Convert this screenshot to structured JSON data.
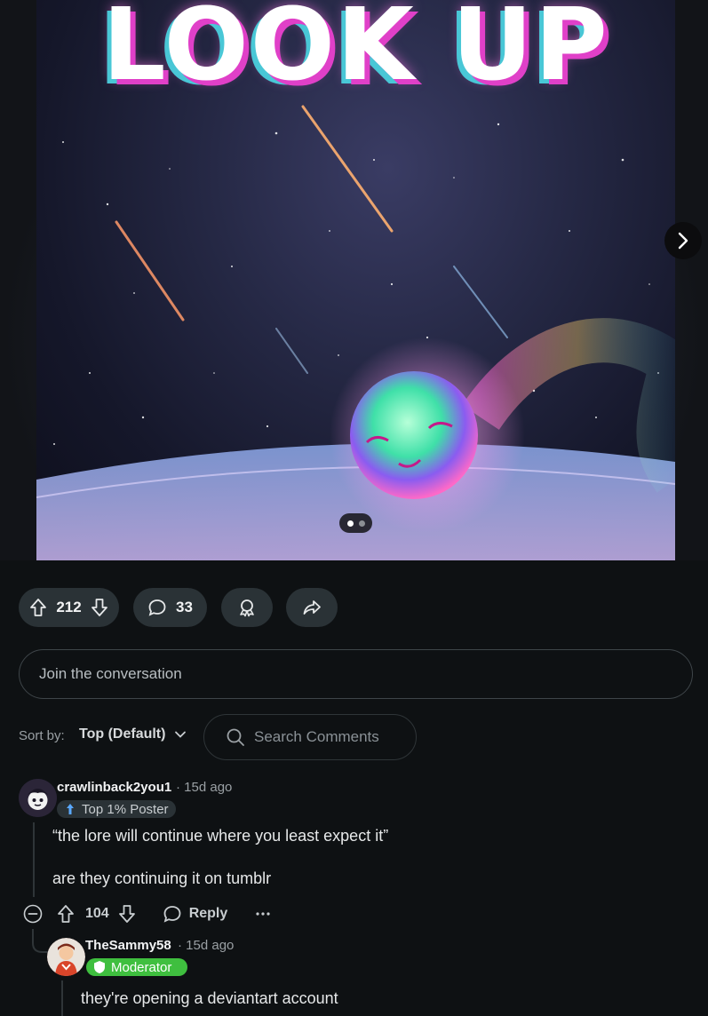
{
  "media": {
    "headline": "LOOK UP",
    "carousel_total": 2,
    "carousel_current": 1
  },
  "actions": {
    "score": "212",
    "comments_count": "33"
  },
  "composer": {
    "placeholder": "Join the conversation"
  },
  "sort": {
    "label": "Sort by:",
    "value": "Top (Default)"
  },
  "search": {
    "placeholder": "Search Comments"
  },
  "comments": [
    {
      "author": "crawlinback2you1",
      "time": "15d ago",
      "flair": "Top 1% Poster",
      "line1": "“the lore will continue where you least expect it”",
      "line2": "are they continuing it on tumblr",
      "score": "104",
      "reply_label": "Reply"
    },
    {
      "author": "TheSammy58",
      "time": "15d ago",
      "flair": "Moderator",
      "line1": "they're opening a deviantart account"
    }
  ],
  "colors": {
    "background": "#0e1113",
    "pill": "#2a3236",
    "moderator": "#3fbf3f"
  }
}
